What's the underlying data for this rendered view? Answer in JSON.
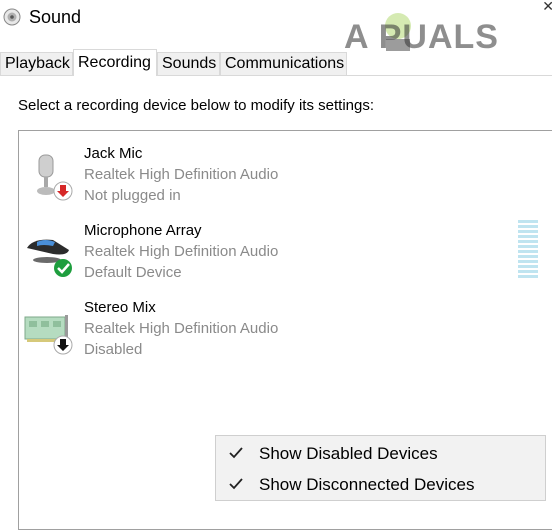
{
  "window": {
    "title": "Sound",
    "title_icon": "speaker-icon",
    "close_icon": "close-icon"
  },
  "watermark": {
    "text": "A PUALS"
  },
  "tabs": [
    {
      "label": "Playback",
      "active": false
    },
    {
      "label": "Recording",
      "active": true
    },
    {
      "label": "Sounds",
      "active": false
    },
    {
      "label": "Communications",
      "active": false
    }
  ],
  "instruction": "Select a recording device below to modify its settings:",
  "devices": [
    {
      "name": "Jack Mic",
      "driver": "Realtek High Definition Audio",
      "status": "Not plugged in",
      "icon": "microphone-icon",
      "badge": "red-down-arrow-badge"
    },
    {
      "name": "Microphone Array",
      "driver": "Realtek High Definition Audio",
      "status": "Default Device",
      "icon": "microphone-array-icon",
      "badge": "green-check-badge"
    },
    {
      "name": "Stereo Mix",
      "driver": "Realtek High Definition Audio",
      "status": "Disabled",
      "icon": "sound-card-icon",
      "badge": "black-down-arrow-badge"
    }
  ],
  "context_menu": {
    "items": [
      {
        "label": "Show Disabled Devices",
        "checked": true
      },
      {
        "label": "Show Disconnected Devices",
        "checked": true
      }
    ]
  },
  "colors": {
    "accent": "#cce4f7",
    "check_bg": "#99c9ef",
    "default_badge": "#1e9e3e",
    "disconnected_badge": "#d62828"
  }
}
